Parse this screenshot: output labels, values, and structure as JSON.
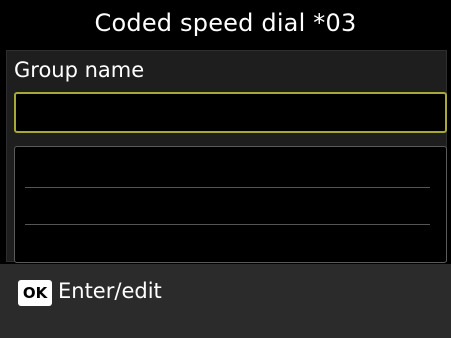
{
  "screen": {
    "title": "Coded speed dial *03"
  },
  "form": {
    "field_label": "Group name",
    "group_name_value": ""
  },
  "entries": [],
  "footer": {
    "key_label": "OK",
    "action_label": "Enter/edit"
  },
  "colors": {
    "input_border": "#a8a73a",
    "background": "#000000",
    "footer": "#2b2b2b"
  }
}
